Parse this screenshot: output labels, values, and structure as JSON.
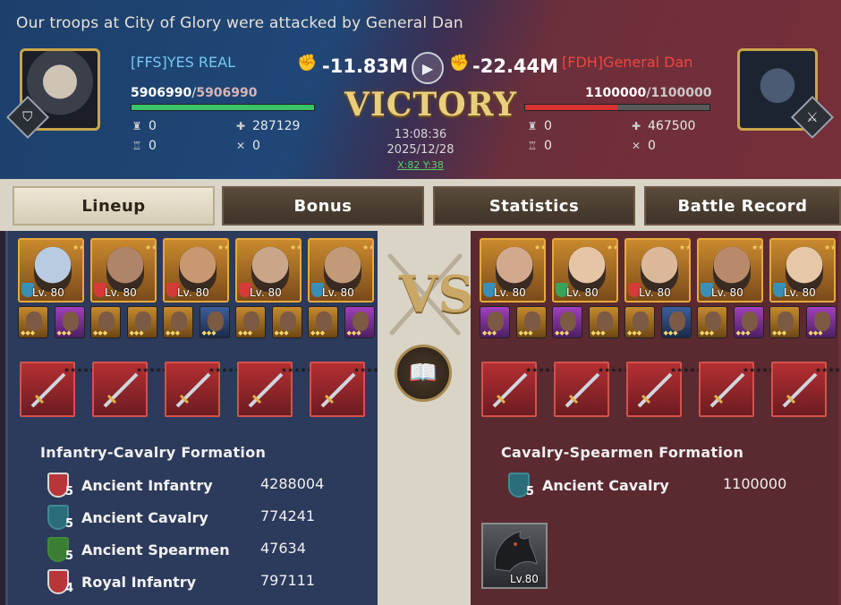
{
  "header": {
    "title": "Our troops at City of Glory were attacked by General Dan",
    "time": "13:08:36",
    "date": "2025/12/28",
    "coords": "X:82 Y:38",
    "result": "Victory"
  },
  "attacker": {
    "name": "[FFS]YES REAL",
    "power": "-11.83M",
    "hp_current": "5906990",
    "hp_max": "5906990",
    "hp_fraction": 1.0,
    "stats": {
      "top_left": "0",
      "bottom_left": "0",
      "top_right": "287129",
      "bottom_right": "0"
    },
    "formation": "Infantry-Cavalry Formation",
    "troops": [
      {
        "name": "Ancient Infantry",
        "tier": "5",
        "count": "4288004",
        "type": "infantry"
      },
      {
        "name": "Ancient Cavalry",
        "tier": "5",
        "count": "774241",
        "type": "cavalry"
      },
      {
        "name": "Ancient Spearmen",
        "tier": "5",
        "count": "47634",
        "type": "spearmen"
      },
      {
        "name": "Royal Infantry",
        "tier": "4",
        "count": "797111",
        "type": "infantry"
      }
    ],
    "heroes": [
      {
        "level": "Lv. 80",
        "cls_color": "#3a8fb7",
        "skin": "#b9cbe0"
      },
      {
        "level": "Lv. 80",
        "cls_color": "#d63a3a",
        "skin": "#b08468"
      },
      {
        "level": "Lv. 80",
        "cls_color": "#d63a3a",
        "skin": "#c89870"
      },
      {
        "level": "Lv. 80",
        "cls_color": "#d63a3a",
        "skin": "#c9a68a"
      },
      {
        "level": "Lv. 80",
        "cls_color": "#3a8fb7",
        "skin": "#c29a78"
      }
    ],
    "mini_colors": [
      "gold",
      "purple",
      "gold",
      "gold",
      "gold",
      "blue",
      "gold",
      "gold",
      "gold",
      "purple"
    ]
  },
  "defender": {
    "name": "[FDH]General Dan",
    "power": "-22.44M",
    "hp_current": "1100000",
    "hp_max": "1100000",
    "hp_fraction": 0.5,
    "stats": {
      "top_left": "0",
      "bottom_left": "0",
      "top_right": "467500",
      "bottom_right": "0"
    },
    "formation": "Cavalry-Spearmen Formation",
    "troops": [
      {
        "name": "Ancient Cavalry",
        "tier": "5",
        "count": "1100000",
        "type": "cavalry"
      }
    ],
    "heroes": [
      {
        "level": "Lv. 80",
        "cls_color": "#3a8fb7",
        "skin": "#d2a88e"
      },
      {
        "level": "Lv. 80",
        "cls_color": "#3aa25a",
        "skin": "#e6c4a6"
      },
      {
        "level": "Lv. 80",
        "cls_color": "#d63a3a",
        "skin": "#dcb89a"
      },
      {
        "level": "Lv. 80",
        "cls_color": "#3a8fb7",
        "skin": "#b98a6a"
      },
      {
        "level": "Lv. 80",
        "cls_color": "#3a8fb7",
        "skin": "#e6c8a8"
      }
    ],
    "mini_colors": [
      "purple",
      "gold",
      "purple",
      "gold",
      "gold",
      "blue",
      "gold",
      "purple",
      "gold",
      "purple"
    ],
    "dragon_level": "Lv.80"
  },
  "tabs": [
    {
      "label": "Lineup",
      "active": true
    },
    {
      "label": "Bonus",
      "active": false
    },
    {
      "label": "Statistics",
      "active": false
    },
    {
      "label": "Battle Record",
      "active": false
    }
  ],
  "vs_label": "VS",
  "colors": {
    "attacker": "#76c8f2",
    "defender": "#f0463e",
    "gold": "#e9cf7d"
  }
}
